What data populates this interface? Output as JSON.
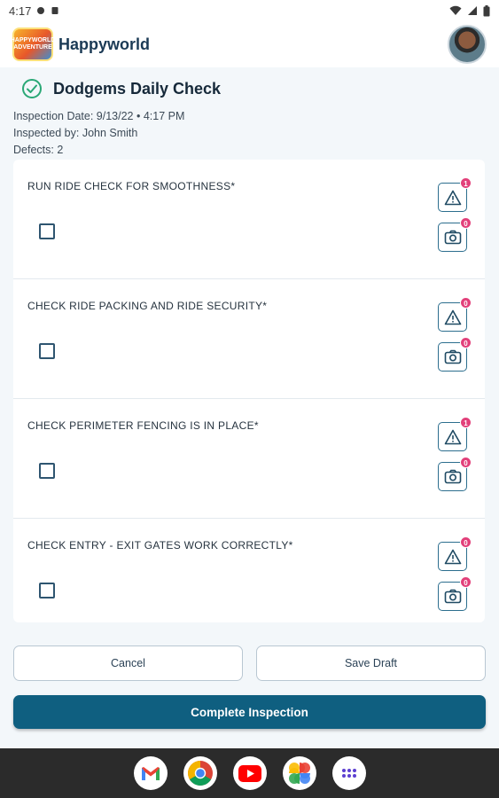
{
  "status_bar": {
    "time": "4:17",
    "icons": [
      "chat-icon",
      "sd-card-icon",
      "wifi-icon",
      "signal-icon",
      "battery-icon"
    ]
  },
  "header": {
    "app_name": "Happyworld",
    "logo_text": "HAPPYWORLD ADVENTURE"
  },
  "inspection": {
    "title": "Dodgems Daily Check",
    "date_line": "Inspection Date: 9/13/22 • 4:17 PM",
    "inspector_line": "Inspected by: John Smith",
    "defects_line": "Defects: 2"
  },
  "items": [
    {
      "label": "RUN RIDE CHECK FOR SMOOTHNESS*",
      "defects": "1",
      "photos": "0",
      "checked": false
    },
    {
      "label": "CHECK RIDE PACKING AND RIDE SECURITY*",
      "defects": "0",
      "photos": "0",
      "checked": false
    },
    {
      "label": "CHECK PERIMETER FENCING IS IN PLACE*",
      "defects": "1",
      "photos": "0",
      "checked": false
    },
    {
      "label": "CHECK ENTRY - EXIT GATES WORK CORRECTLY*",
      "defects": "0",
      "photos": "0",
      "checked": false
    }
  ],
  "buttons": {
    "cancel": "Cancel",
    "save_draft": "Save Draft",
    "complete": "Complete Inspection"
  },
  "colors": {
    "primary": "#0f5f80",
    "badge": "#e2407a",
    "success": "#2aa876"
  },
  "dock": [
    "gmail-icon",
    "chrome-icon",
    "youtube-icon",
    "photos-icon",
    "apps-icon"
  ]
}
